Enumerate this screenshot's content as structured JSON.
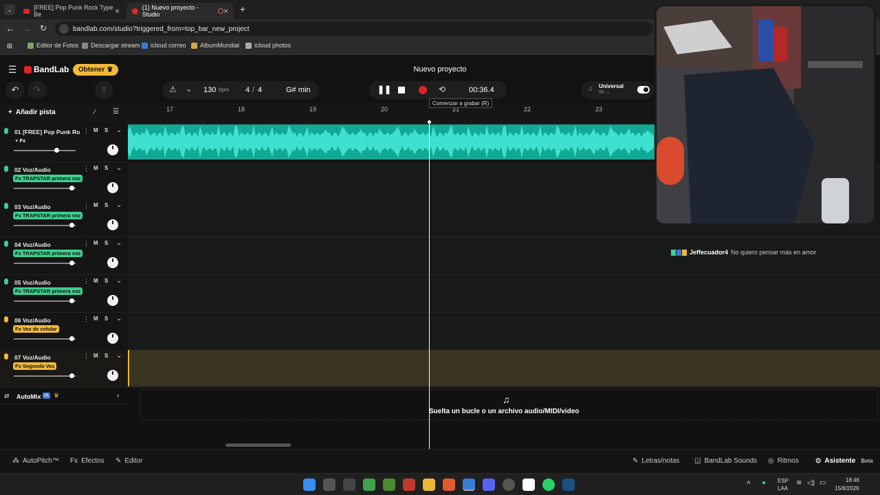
{
  "browser": {
    "tabs": [
      {
        "title": "[FREE] Pop Punk Rock Type Be",
        "active": false
      },
      {
        "title": "(1) Nuevo proyecto - Studio",
        "active": true
      }
    ],
    "url": "bandlab.com/studio?triggered_from=top_bar_new_project",
    "bookmarks": [
      "Editor de Fotos",
      "Descargar stream",
      "icloud correo",
      "AlbumMundial",
      "icloud photos"
    ]
  },
  "app": {
    "logo": "BandLab",
    "get_label": "Obtener",
    "project_title": "Nuevo proyecto"
  },
  "toolbar": {
    "bpm": "130",
    "bpm_unit": "bpm",
    "time_sig_num": "4",
    "time_sig_den": "4",
    "key": "G# min",
    "time": "00:36.4",
    "tooltip": "Comenzar a grabar (R)",
    "preset_name": "Universal",
    "preset_value": "50"
  },
  "add_track_label": "Añadir pista",
  "ruler": [
    "17",
    "18",
    "19",
    "20",
    "21",
    "22",
    "23"
  ],
  "tracks": [
    {
      "name": "01  [FREE] Pop Punk Ro...",
      "fx": "+ Fx",
      "fx_color": "none",
      "mic_color": "#3ccf8e",
      "volume": 0.7
    },
    {
      "name": "02  Voz/Audio",
      "fx": "Fx TRAPSTAR primera voz",
      "fx_color": "#3ccf8e",
      "mic_color": "#3ccf8e",
      "volume": 0.95
    },
    {
      "name": "03  Voz/Audio",
      "fx": "Fx TRAPSTAR primera voz",
      "fx_color": "#3ccf8e",
      "mic_color": "#3ccf8e",
      "volume": 0.95
    },
    {
      "name": "04  Voz/Audio",
      "fx": "Fx TRAPSTAR primera voz",
      "fx_color": "#3ccf8e",
      "mic_color": "#3ccf8e",
      "volume": 0.95
    },
    {
      "name": "05  Voz/Audio",
      "fx": "Fx TRAPSTAR primera voz",
      "fx_color": "#3ccf8e",
      "mic_color": "#3ccf8e",
      "volume": 0.95
    },
    {
      "name": "06  Voz/Audio",
      "fx": "Fx Voz de celular",
      "fx_color": "#f0b93a",
      "mic_color": "#f0b93a",
      "volume": 0.95
    },
    {
      "name": "07  Voz/Audio",
      "fx": "Fx Segunda Voz",
      "fx_color": "#f0b93a",
      "mic_color": "#f0b93a",
      "volume": 0.95
    }
  ],
  "automix": {
    "label": "AutoMix",
    "badge": "IA"
  },
  "dropzone_text": "Suelta un bucle o un archivo audio/MIDI/video",
  "chat": {
    "user": "Jeffecuador4",
    "message": "No quiero pensar más en amor"
  },
  "footer": {
    "left": [
      "AutoPitch™",
      "Efectos",
      "Editor"
    ],
    "right": [
      "Letras/notas",
      "BandLab Sounds",
      "Ritmos"
    ],
    "assistant": "Asistente",
    "beta": "Beta"
  },
  "taskbar": {
    "lang1": "ESP",
    "lang2": "LAA",
    "time": "18:46",
    "date": "15/8/2026"
  },
  "colors": {
    "wave": "#13a896",
    "accent": "#f0b93a",
    "record": "#e02424"
  }
}
